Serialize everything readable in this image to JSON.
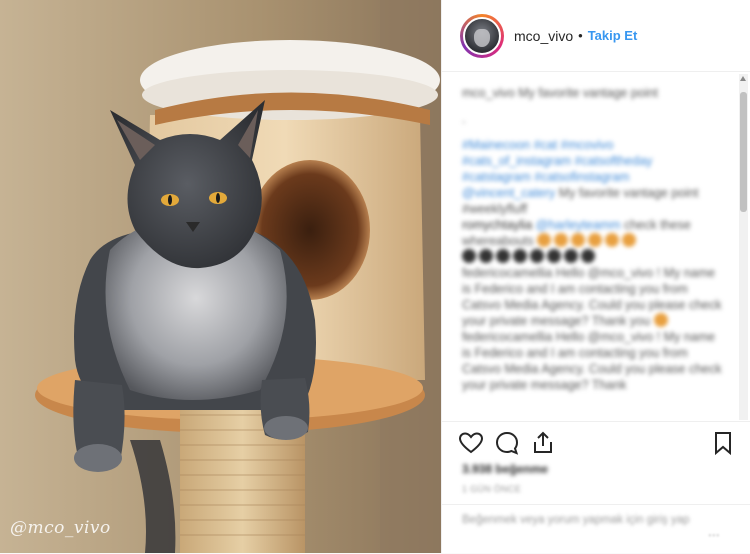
{
  "photo": {
    "watermark": "@mco_vivo"
  },
  "header": {
    "username": "mco_vivo",
    "separator": "•",
    "follow_label": "Takip Et"
  },
  "comments": [
    {
      "text": "mco_vivo My favorite vantage point"
    },
    {
      "text": "."
    },
    {
      "text": "#Mainecoon #cat #mcovivo #cats_of_instagram #catsoftheday #catstagram #catsofinstagram"
    },
    {
      "user": "@vincent_catery",
      "text": "My favorite vantage point #weeklyfluff"
    },
    {
      "user": "romychtaylia",
      "tag": "@harleyteamm",
      "text": "check these whereabouts"
    },
    {
      "text": "federicocamellia Hello @mco_vivo ! My name is Federico and I am contacting you from Catsvo Media Agency. Could you please check your private message? Thank you"
    },
    {
      "text": "federicocamellia Hello @mco_vivo ! My name is Federico and I am contacting you from Catsvo Media Agency. Could you please check your private message? Thank"
    }
  ],
  "stats": {
    "likes": "3.938 beğenme",
    "time": "1 GÜN ÖNCE"
  },
  "add_comment": {
    "placeholder": "Beğenmek veya yorum yapmak için giriş yap",
    "more": "..."
  },
  "icons": [
    "heart-icon",
    "comment-icon",
    "share-icon",
    "bookmark-icon"
  ],
  "colors": {
    "accent": "#3897f0",
    "text": "#262626"
  }
}
